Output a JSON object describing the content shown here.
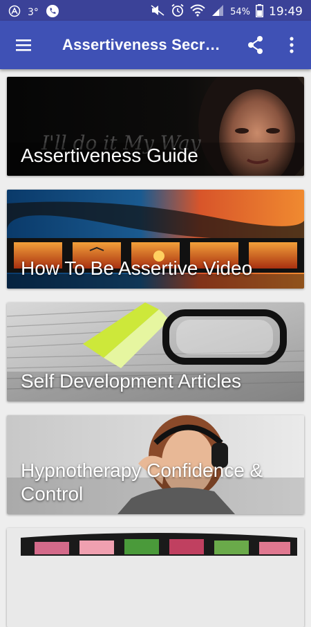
{
  "status_bar": {
    "notification_count": "3°",
    "battery_percent": "54%",
    "time": "19:49"
  },
  "app_bar": {
    "title": "Assertiveness Secr…"
  },
  "cards": [
    {
      "label": "Assertiveness Guide",
      "image_overlay_text": "I'll do it My Way"
    },
    {
      "label": "How To Be Assertive Video"
    },
    {
      "label": "Self Development Articles"
    },
    {
      "label": "Hypnotherapy Confidence & Control"
    },
    {
      "label": ""
    }
  ],
  "colors": {
    "status_bar": "#3b4298",
    "app_bar": "#3f51b5",
    "background": "#eeeeee"
  }
}
